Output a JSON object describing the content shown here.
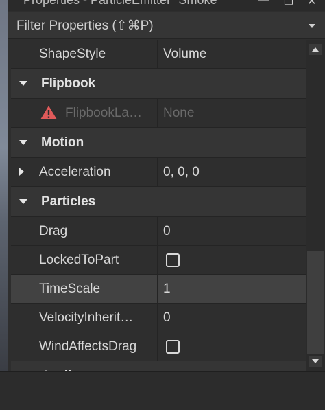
{
  "window": {
    "title": "Properties - ParticleEmitter \"Smoke\""
  },
  "filter": {
    "placeholder": "Filter Properties (⇧⌘P)"
  },
  "rows": {
    "shape_style": {
      "name": "ShapeStyle",
      "value": "Volume"
    },
    "flipbook_section": {
      "name": "Flipbook"
    },
    "flipbook_layout": {
      "name": "FlipbookLa…",
      "value": "None",
      "icon": "warning-icon"
    },
    "motion_section": {
      "name": "Motion"
    },
    "acceleration": {
      "name": "Acceleration",
      "value": "0, 0, 0"
    },
    "particles_section": {
      "name": "Particles"
    },
    "drag": {
      "name": "Drag",
      "value": "0"
    },
    "locked_to_part": {
      "name": "LockedToPart",
      "checked": false
    },
    "time_scale": {
      "name": "TimeScale",
      "value": "1"
    },
    "velocity_inheritance": {
      "name": "VelocityInherit…",
      "value": "0"
    },
    "wind_affects_drag": {
      "name": "WindAffectsDrag",
      "checked": false
    },
    "attributes_section": {
      "name": "Attributes"
    }
  },
  "colors": {
    "background": "#2e2e2e",
    "section": "#353535",
    "selected_row": "#424242",
    "warning": "#e05a5a",
    "disabled_text": "#6a6a6a"
  }
}
